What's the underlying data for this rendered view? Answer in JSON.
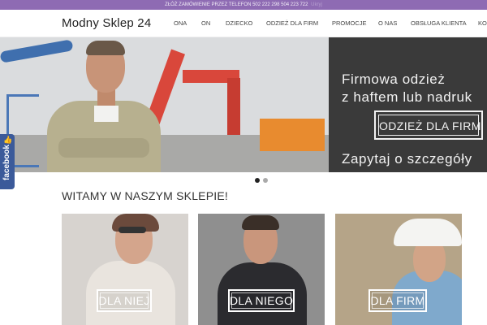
{
  "topbar": {
    "text": "ZŁÓŻ ZAMÓWIENIE PRZEZ TELEFON 502 222 298 504 223 722",
    "hint": "Ukryj"
  },
  "header": {
    "logo": "Modny Sklep 24",
    "nav": [
      "ONA",
      "ON",
      "DZIECKO",
      "ODZIEŻ DLA FIRM",
      "PROMOCJE",
      "O NAS",
      "OBSŁUGA KLIENTA",
      "KO"
    ]
  },
  "hero": {
    "line1": "Firmowa odzież",
    "line2": "z haftem lub nadruk",
    "button": "ODZIEŻ DLA FIRM",
    "line3": "Zapytaj o szczegóły"
  },
  "facebook": {
    "label": "facebook",
    "icon": "thumbs-up-icon"
  },
  "slider": {
    "slides": 2,
    "active": 1
  },
  "section": {
    "title": "WITAMY W NASZYM SKLEPIE!"
  },
  "categories": [
    {
      "label": "DLA NIEJ"
    },
    {
      "label": "DLA NIEGO"
    },
    {
      "label": "DLA FIRM"
    }
  ],
  "colors": {
    "topbar": "#8e6bb3",
    "hero_panel": "#3a3a3a",
    "facebook": "#3b5a9a"
  }
}
